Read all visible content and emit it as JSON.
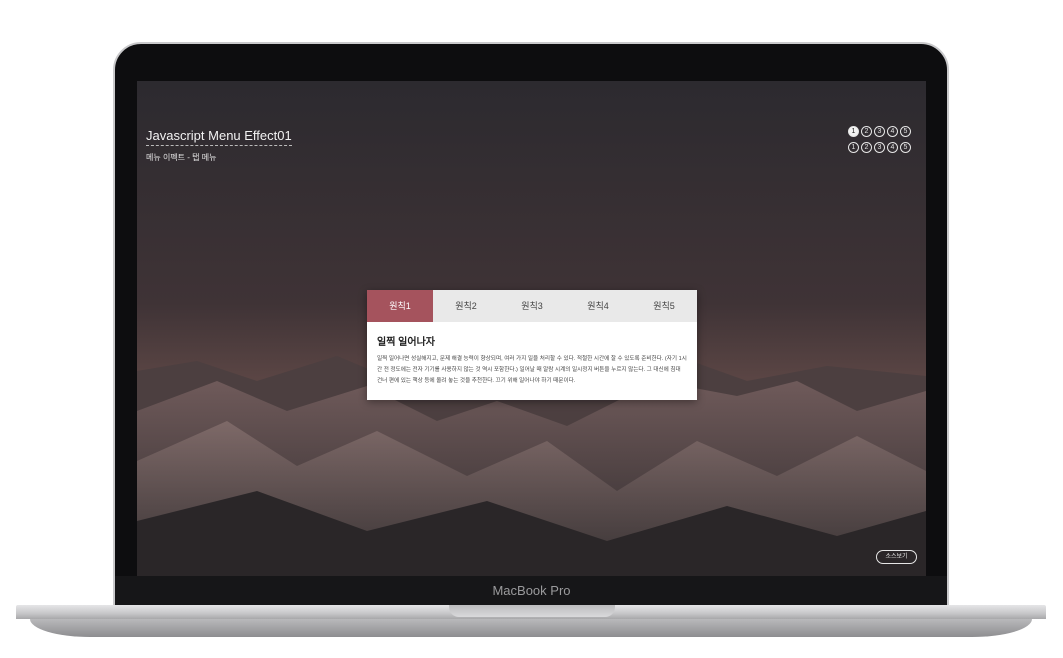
{
  "device": {
    "bezel_label": "MacBook Pro"
  },
  "page": {
    "title": "Javascript Menu Effect01",
    "subtitle": "메뉴 이펙트 - 탭 메뉴"
  },
  "pager_row1": [
    "1",
    "2",
    "3",
    "4",
    "5"
  ],
  "pager_row2": [
    "1",
    "2",
    "3",
    "4",
    "5"
  ],
  "tabs": [
    {
      "label": "원칙1"
    },
    {
      "label": "원칙2"
    },
    {
      "label": "원칙3"
    },
    {
      "label": "원칙4"
    },
    {
      "label": "원칙5"
    }
  ],
  "content": {
    "heading": "일찍 일어나자",
    "body": "일찍 일어나면 성실해지고, 문제 해결 능력이 향상되며, 여러 가지 일을 처리할 수 있다. 적절한 시간에 잘 수 있도록 준비한다. (자기 1시간 전 정도에는 전자 기기를 사용하지 않는 것 역시 포함한다.) 일어날 때 알람 시계의 일시정지 버튼을 누르지 않는다. 그 대신에 침대 건너 편에 있는 책상 등에 올려 놓는 것을 추천한다. 끄기 위해 일어나야 하기 때문이다."
  },
  "source_button": "소스보기",
  "colors": {
    "accent": "#a5535d",
    "tab_bg": "#e9e9e9"
  }
}
